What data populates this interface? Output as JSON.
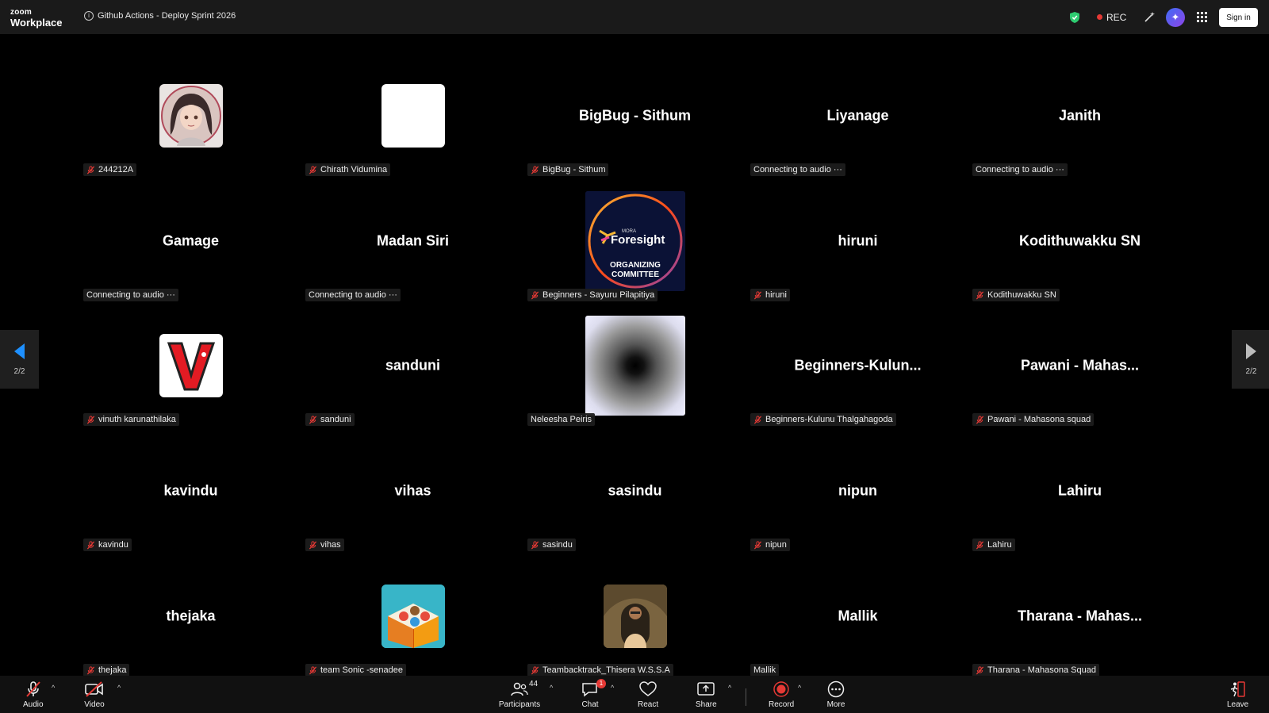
{
  "app": {
    "logo_line1": "zoom",
    "logo_line2": "Workplace"
  },
  "meeting": {
    "title": "Github Actions - Deploy Sprint 2026"
  },
  "topbar": {
    "rec_label": "REC",
    "signin_label": "Sign in"
  },
  "pagination": {
    "left": "2/2",
    "right": "2/2"
  },
  "tiles": [
    {
      "big": "",
      "name": "244212A",
      "muted": true,
      "avatar": "anime-girl"
    },
    {
      "big": "",
      "name": "Chirath Vidumina",
      "muted": true,
      "avatar": "blank-white"
    },
    {
      "big": "BigBug - Sithum",
      "name": "BigBug - Sithum",
      "muted": true,
      "avatar": ""
    },
    {
      "big": "Liyanage",
      "name": "Connecting to audio ···",
      "muted": false,
      "avatar": ""
    },
    {
      "big": "Janith",
      "name": "Connecting to audio ···",
      "muted": false,
      "avatar": ""
    },
    {
      "big": "Gamage",
      "name": "Connecting to audio ···",
      "muted": false,
      "avatar": ""
    },
    {
      "big": "Madan Siri",
      "name": "Connecting to audio ···",
      "muted": false,
      "avatar": ""
    },
    {
      "big": "",
      "name": "Beginners - Sayuru Pilapitiya",
      "muted": true,
      "avatar": "foresight"
    },
    {
      "big": "hiruni",
      "name": "hiruni",
      "muted": true,
      "avatar": ""
    },
    {
      "big": "Kodithuwakku SN",
      "name": "Kodithuwakku SN",
      "muted": true,
      "avatar": ""
    },
    {
      "big": "",
      "name": "vinuth karunathilaka",
      "muted": true,
      "avatar": "letter-v"
    },
    {
      "big": "sanduni",
      "name": "sanduni",
      "muted": true,
      "avatar": ""
    },
    {
      "big": "",
      "name": "Neleesha Peiris",
      "muted": false,
      "avatar": "tunnel"
    },
    {
      "big": "Beginners-Kulun...",
      "name": "Beginners-Kulunu Thalgahagoda",
      "muted": true,
      "avatar": ""
    },
    {
      "big": "Pawani - Mahas...",
      "name": "Pawani - Mahasona squad",
      "muted": true,
      "avatar": ""
    },
    {
      "big": "kavindu",
      "name": "kavindu",
      "muted": true,
      "avatar": ""
    },
    {
      "big": "vihas",
      "name": "vihas",
      "muted": true,
      "avatar": ""
    },
    {
      "big": "sasindu",
      "name": "sasindu",
      "muted": true,
      "avatar": ""
    },
    {
      "big": "nipun",
      "name": "nipun",
      "muted": true,
      "avatar": ""
    },
    {
      "big": "Lahiru",
      "name": "Lahiru",
      "muted": true,
      "avatar": ""
    },
    {
      "big": "thejaka",
      "name": "thejaka",
      "muted": true,
      "avatar": ""
    },
    {
      "big": "",
      "name": "team Sonic -senadee",
      "muted": true,
      "avatar": "boxes"
    },
    {
      "big": "",
      "name": "Teambacktrack_Thisera W.S.S.A",
      "muted": true,
      "avatar": "person-photo"
    },
    {
      "big": "Mallik",
      "name": "Mallik",
      "muted": false,
      "avatar": ""
    },
    {
      "big": "Tharana - Mahas...",
      "name": "Tharana - Mahasona Squad",
      "muted": true,
      "avatar": ""
    }
  ],
  "toolbar": {
    "audio": "Audio",
    "video": "Video",
    "participants": "Participants",
    "participants_count": "44",
    "chat": "Chat",
    "chat_badge": "1",
    "react": "React",
    "share": "Share",
    "record": "Record",
    "more": "More",
    "leave": "Leave"
  },
  "colors": {
    "accent_blue": "#1e90ff",
    "rec_red": "#e53935",
    "shield_green": "#2ecc71",
    "leave_red": "#e53935"
  }
}
